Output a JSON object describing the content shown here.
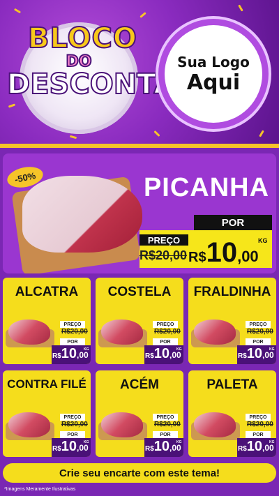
{
  "header": {
    "logo_line1": "BLOCO",
    "logo_line2": "DO",
    "logo_line3": "DESCONTÃO",
    "badge_line1": "Sua Logo",
    "badge_line2": "Aqui",
    "accent_color": "#f6c429",
    "purple_color": "#8a2bbf"
  },
  "hero": {
    "discount": "-50%",
    "product": "PICANHA",
    "preco_label": "PREÇO",
    "por_label": "POR",
    "old_price": "R$20,00",
    "currency": "R$",
    "price_int": "10",
    "price_cents": ",00",
    "unit": "KG"
  },
  "cards": [
    {
      "name": "ALCATRA",
      "preco_label": "PREÇO",
      "old_price": "R$20,00",
      "por_label": "POR",
      "currency": "R$",
      "price_int": "10",
      "price_cents": ",00",
      "unit": "KG"
    },
    {
      "name": "COSTELA",
      "preco_label": "PREÇO",
      "old_price": "R$20,00",
      "por_label": "POR",
      "currency": "R$",
      "price_int": "10",
      "price_cents": ",00",
      "unit": "KG"
    },
    {
      "name": "FRALDINHA",
      "preco_label": "PREÇO",
      "old_price": "R$20,00",
      "por_label": "POR",
      "currency": "R$",
      "price_int": "10",
      "price_cents": ",00",
      "unit": "KG"
    },
    {
      "name": "CONTRA FILÉ",
      "preco_label": "PREÇO",
      "old_price": "R$20,00",
      "por_label": "POR",
      "currency": "R$",
      "price_int": "10",
      "price_cents": ",00",
      "unit": "KG"
    },
    {
      "name": "ACÉM",
      "preco_label": "PREÇO",
      "old_price": "R$20,00",
      "por_label": "POR",
      "currency": "R$",
      "price_int": "10",
      "price_cents": ",00",
      "unit": "KG"
    },
    {
      "name": "PALETA",
      "preco_label": "PREÇO",
      "old_price": "R$20,00",
      "por_label": "POR",
      "currency": "R$",
      "price_int": "10",
      "price_cents": ",00",
      "unit": "KG"
    }
  ],
  "footer": {
    "cta": "Crie seu encarte com este tema!",
    "disclaimer": "*Imagens Meramente Ilustrativas"
  }
}
